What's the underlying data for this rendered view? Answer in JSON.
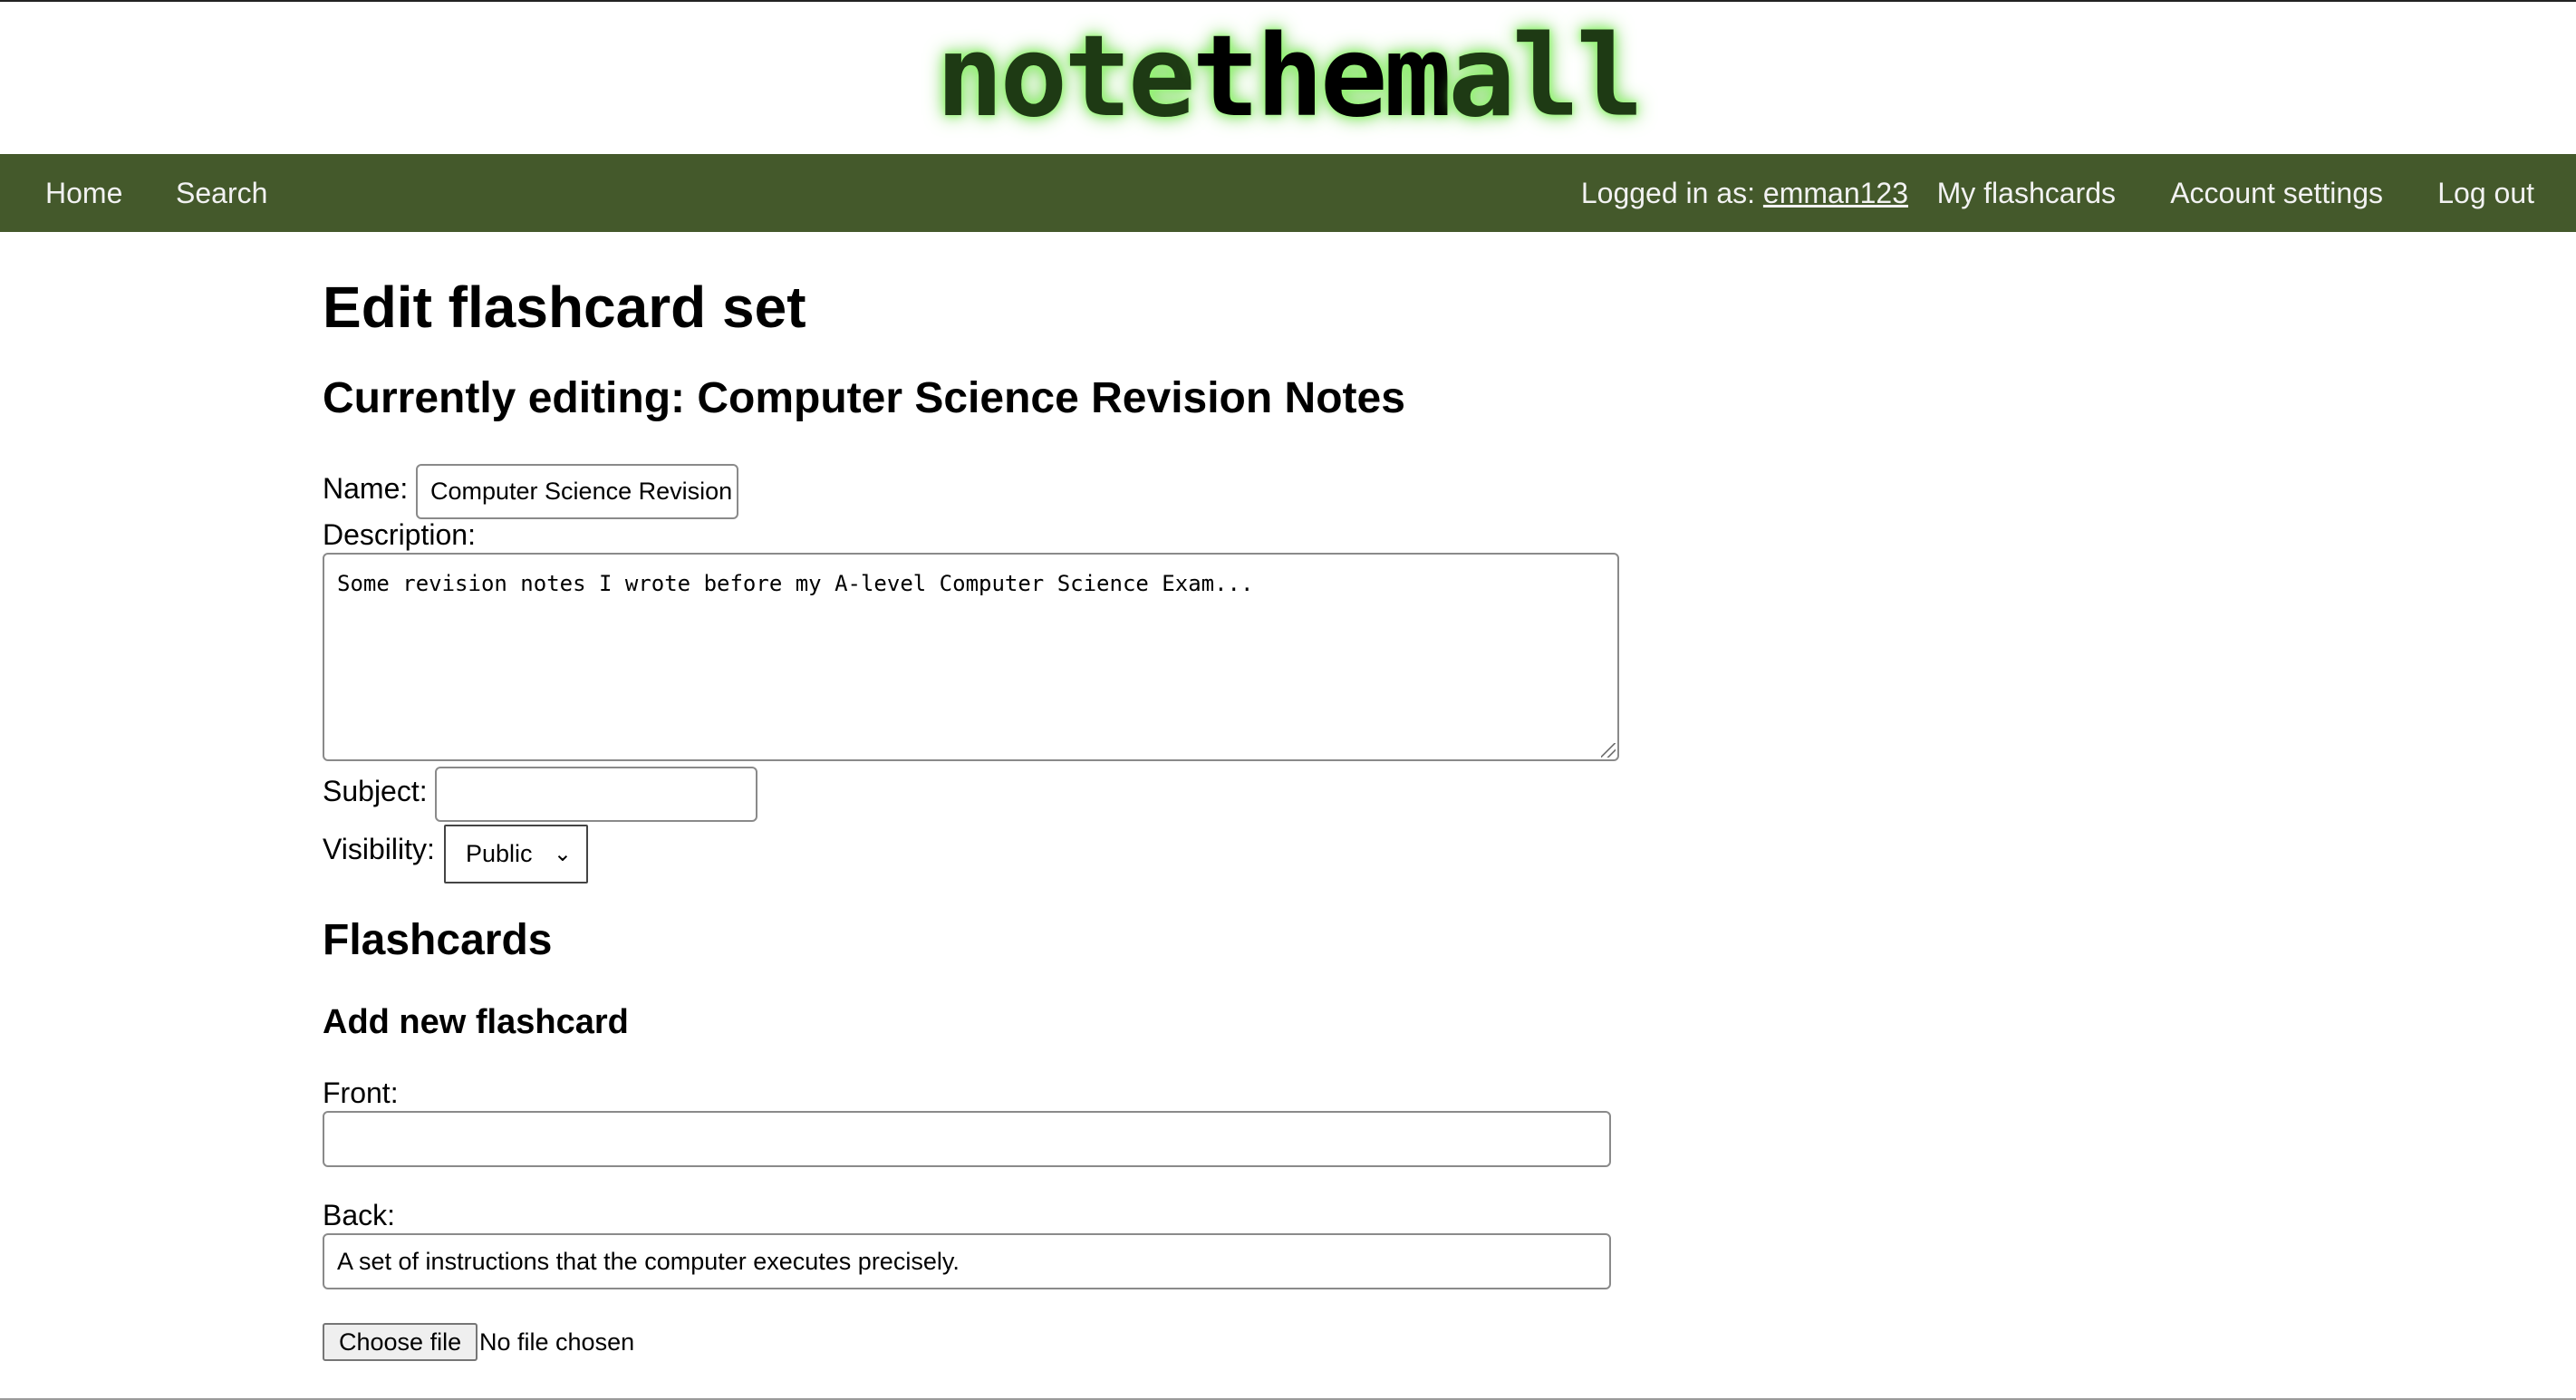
{
  "header": {
    "logo_part1": "note",
    "logo_part2": "them",
    "logo_part3": "all"
  },
  "nav": {
    "home": "Home",
    "search": "Search",
    "logged_in_prefix": "Logged in as: ",
    "username": "emman123",
    "my_flashcards": "My flashcards",
    "account_settings": "Account settings",
    "log_out": "Log out",
    "bar_color": "#44592b"
  },
  "page": {
    "title": "Edit flashcard set",
    "currently_editing": "Currently editing: Computer Science Revision Notes"
  },
  "form": {
    "name_label": "Name:",
    "name_value": "Computer Science Revision Notes",
    "description_label": "Description:",
    "description_value": "Some revision notes I wrote before my A-level Computer Science Exam...",
    "subject_label": "Subject:",
    "subject_value": "",
    "visibility_label": "Visibility:",
    "visibility_value": "Public"
  },
  "flashcards": {
    "heading": "Flashcards",
    "add_heading": "Add new flashcard",
    "front_label": "Front:",
    "front_value": "",
    "back_label": "Back:",
    "back_value": "A set of instructions that the computer executes precisely.",
    "choose_file_label": "Choose file",
    "no_file_text": "No file chosen"
  }
}
